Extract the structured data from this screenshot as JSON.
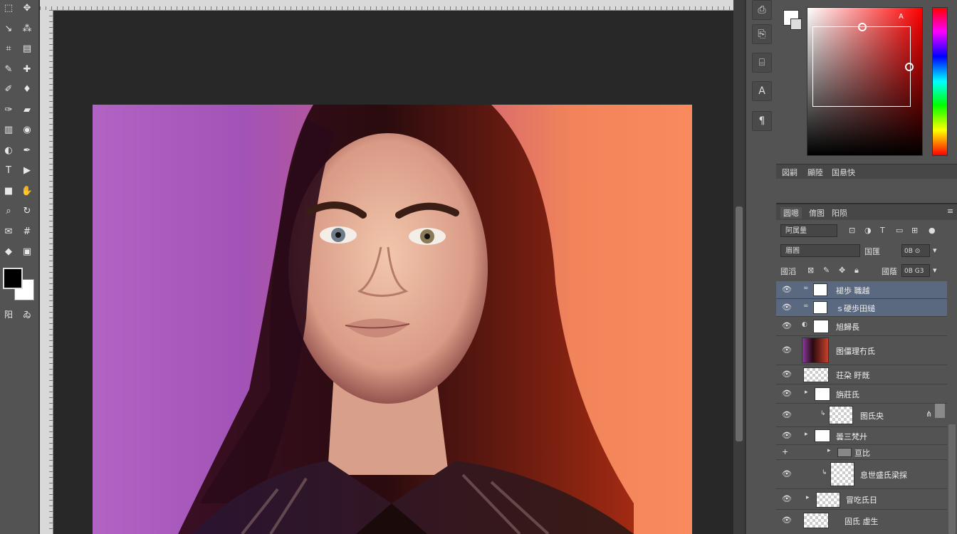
{
  "toolbar": {
    "tools": [
      {
        "icon": "marquee-icon",
        "glyph": "⬚"
      },
      {
        "icon": "move-icon",
        "glyph": "✥"
      },
      {
        "icon": "lasso-icon",
        "glyph": "↘"
      },
      {
        "icon": "magic-wand-icon",
        "glyph": "⁂"
      },
      {
        "icon": "crop-icon",
        "glyph": "⌗"
      },
      {
        "icon": "slice-icon",
        "glyph": "▤"
      },
      {
        "icon": "eyedropper-icon",
        "glyph": "✎"
      },
      {
        "icon": "healing-icon",
        "glyph": "✚"
      },
      {
        "icon": "brush-icon",
        "glyph": "✐"
      },
      {
        "icon": "stamp-icon",
        "glyph": "♦"
      },
      {
        "icon": "history-brush-icon",
        "glyph": "✑"
      },
      {
        "icon": "eraser-icon",
        "glyph": "▰"
      },
      {
        "icon": "gradient-icon",
        "glyph": "▥"
      },
      {
        "icon": "blur-icon",
        "glyph": "◉"
      },
      {
        "icon": "dodge-icon",
        "glyph": "◐"
      },
      {
        "icon": "pen-icon",
        "glyph": "✒"
      },
      {
        "icon": "type-icon",
        "glyph": "T"
      },
      {
        "icon": "path-select-icon",
        "glyph": "▶"
      },
      {
        "icon": "shape-icon",
        "glyph": "■"
      },
      {
        "icon": "hand-icon",
        "glyph": "✋"
      },
      {
        "icon": "zoom-icon",
        "glyph": "⌕"
      },
      {
        "icon": "rotate-view-icon",
        "glyph": "↻"
      },
      {
        "icon": "note-icon",
        "glyph": "✉"
      },
      {
        "icon": "count-icon",
        "glyph": "#"
      },
      {
        "icon": "3d-icon",
        "glyph": "◆"
      },
      {
        "icon": "frame-icon",
        "glyph": "▣"
      }
    ],
    "extra_labels": [
      "阳",
      "ゐ"
    ]
  },
  "side_panel_icons": [
    {
      "icon": "history-panel-icon",
      "glyph": "⎙"
    },
    {
      "icon": "actions-panel-icon",
      "glyph": "⎘"
    },
    {
      "icon": "properties-panel-icon",
      "glyph": "⌸"
    },
    {
      "icon": "character-panel-icon",
      "glyph": "A"
    },
    {
      "icon": "paragraph-panel-icon",
      "glyph": "¶"
    }
  ],
  "color_panel": {
    "tabs": [
      "図嗣",
      "顯陸",
      "国悬快"
    ],
    "fg_color": "#000000",
    "bg_color": "#ffffff"
  },
  "layers_panel": {
    "tabs": [
      "圆嗯",
      "俼图",
      "阳陨"
    ],
    "kind_filter": "阿属量",
    "blend_mode": "眉圓",
    "opacity_label": "国匯",
    "opacity_value": "0B ⊙",
    "lock_label": "國滔",
    "fill_label": "國蔭",
    "fill_value": "0B G3",
    "layers": [
      {
        "name": "褪歩 職越",
        "selected": true
      },
      {
        "name": "ｓ硬歩田縋",
        "selected": true
      },
      {
        "name": "旭歸長",
        "selected": false
      },
      {
        "name": "图僵理冇氐",
        "selected": false
      },
      {
        "name": "荘朶 盱既",
        "selected": false
      },
      {
        "name": "旃莊氐",
        "selected": false
      },
      {
        "name": "图氐央",
        "selected": false
      },
      {
        "name": "曇三梵廾",
        "selected": false
      },
      {
        "name": "亘比",
        "selected": false
      },
      {
        "name": "息世盛氐梁採",
        "selected": false
      },
      {
        "name": "冒吃氐日",
        "selected": false
      },
      {
        "name": "固氐 虛生",
        "selected": false
      }
    ]
  },
  "photo": {
    "bg_left": "#b164c4",
    "bg_right": "#f88a5e"
  }
}
